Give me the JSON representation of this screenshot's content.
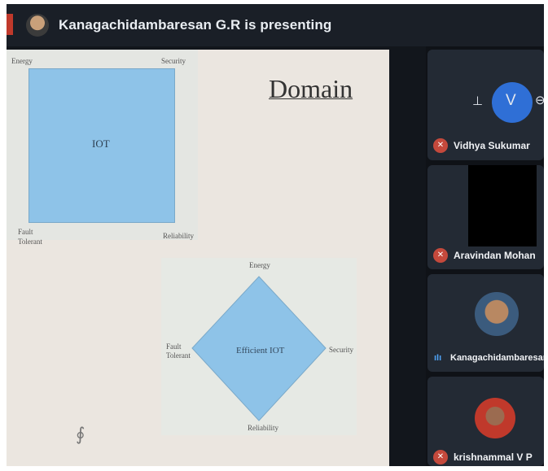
{
  "presenting_banner": "Kanagachidambaresan G.R is presenting",
  "slide": {
    "title": "Domain",
    "square": {
      "label": "IOT",
      "corners": {
        "top_left": "Energy",
        "top_right": "Security",
        "bottom_left": "Fault\nTolerant",
        "bottom_right": "Reliability"
      }
    },
    "diamond": {
      "label": "Efficient IOT",
      "top": "Energy",
      "left": "Fault\nTolerant",
      "right": "Security",
      "bottom": "Reliability"
    }
  },
  "participants": [
    {
      "name": "Vidhya Sukumar",
      "muted": true
    },
    {
      "name": "Aravindan Mohan",
      "muted": true
    },
    {
      "name": "Kanagachidambaresan G.R",
      "speaking": true
    },
    {
      "name": "krishnammal V P",
      "muted": true
    }
  ],
  "controls": {
    "pin_icon": "pin-icon",
    "spotlight_icon": "spotlight-icon",
    "remove_icon": "remove-icon"
  },
  "colors": {
    "accent_blue": "#2f6fd6",
    "mute_red": "#c4493c",
    "slide_blue": "#8ec3e8"
  }
}
